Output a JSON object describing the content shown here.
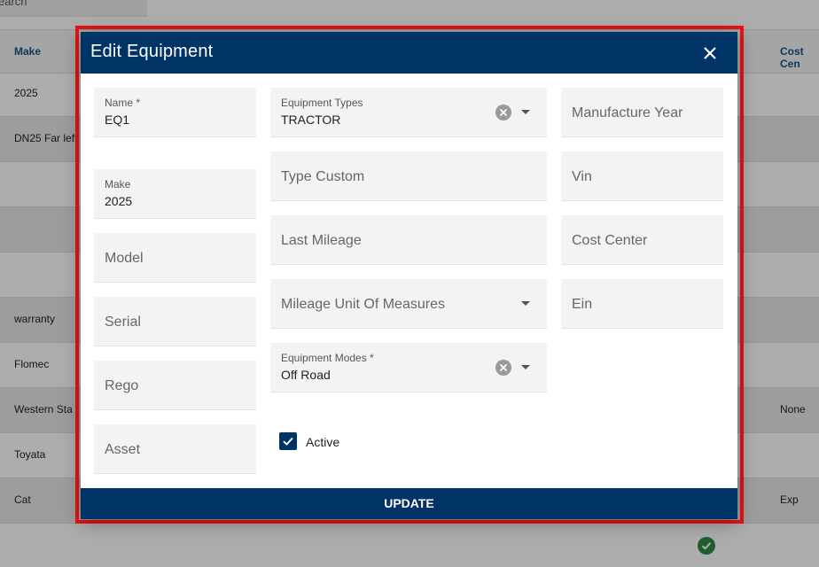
{
  "background": {
    "search_placeholder": "earch",
    "headers": {
      "make": "Make",
      "cost_center": "Cost Cen"
    },
    "rows": [
      {
        "make": "2025",
        "cost_center": ""
      },
      {
        "make": "DN25 Far left",
        "cost_center": ""
      },
      {
        "make": "",
        "cost_center": ""
      },
      {
        "make": "",
        "cost_center": ""
      },
      {
        "make": "",
        "cost_center": ""
      },
      {
        "make": "warranty",
        "cost_center": ""
      },
      {
        "make": "Flomec",
        "cost_center": ""
      },
      {
        "make": "Western Sta",
        "cost_center": "None"
      },
      {
        "make": "Toyata",
        "cost_center": ""
      },
      {
        "make": "Cat",
        "cost_center": "Exp"
      }
    ]
  },
  "modal": {
    "title": "Edit Equipment",
    "fields": {
      "name": {
        "label": "Name *",
        "value": "EQ1"
      },
      "make": {
        "label": "Make",
        "value": "2025"
      },
      "model": {
        "placeholder": "Model"
      },
      "serial": {
        "placeholder": "Serial"
      },
      "rego": {
        "placeholder": "Rego"
      },
      "asset": {
        "placeholder": "Asset"
      },
      "equipment_types": {
        "label": "Equipment Types",
        "value": "TRACTOR"
      },
      "type_custom": {
        "placeholder": "Type Custom"
      },
      "last_mileage": {
        "placeholder": "Last Mileage"
      },
      "mileage_unit": {
        "placeholder": "Mileage Unit Of Measures"
      },
      "equipment_modes": {
        "label": "Equipment Modes *",
        "value": "Off Road"
      },
      "manufacture_year": {
        "placeholder": "Manufacture Year"
      },
      "vin": {
        "placeholder": "Vin"
      },
      "cost_center": {
        "placeholder": "Cost Center"
      },
      "ein": {
        "placeholder": "Ein"
      }
    },
    "active": {
      "label": "Active",
      "checked": true
    },
    "update_label": "UPDATE"
  },
  "colors": {
    "primary": "#003366",
    "highlight_border": "#ee1111",
    "success": "#2e8b3f"
  }
}
